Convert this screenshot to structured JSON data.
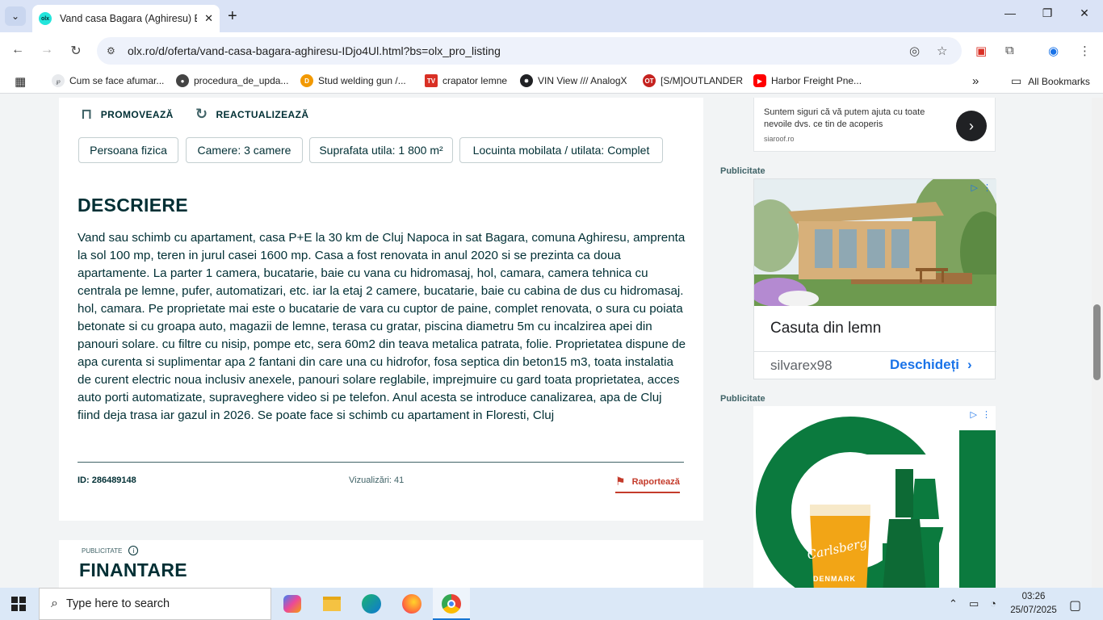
{
  "browser": {
    "tab_title": "Vand casa Bagara (Aghiresu) Ba",
    "favicon_text": "olx",
    "url": "olx.ro/d/oferta/vand-casa-bagara-aghiresu-IDjo4Ul.html?bs=olx_pro_listing",
    "bookmarks": [
      {
        "label": "Cum se face afumar...",
        "color": "#5f6368"
      },
      {
        "label": "procedura_de_upda...",
        "color": "#444"
      },
      {
        "label": "Stud welding gun /...",
        "color": "#f29900"
      },
      {
        "label": "crapator lemne",
        "color": "#d93025"
      },
      {
        "label": "VIN View /// AnalogX",
        "color": "#202124"
      },
      {
        "label": "[S/M]OUTLANDER",
        "color": "#c5221f"
      },
      {
        "label": "Harbor Freight Pne...",
        "color": "#ff0000"
      }
    ],
    "all_bookmarks": "All Bookmarks"
  },
  "listing": {
    "promote": "PROMOVEAZĂ",
    "refresh": "REACTUALIZEAZĂ",
    "tags": [
      "Persoana fizica",
      "Camere: 3 camere",
      "Suprafata utila: 1 800 m²",
      "Locuinta mobilata / utilata: Complet"
    ],
    "description_heading": "DESCRIERE",
    "description": "Vand sau schimb cu apartament, casa P+E la 30 km de Cluj Napoca in sat Bagara, comuna Aghiresu, amprenta la sol 100 mp, teren in jurul casei 1600 mp. Casa a fost renovata in anul 2020 si se prezinta ca doua apartamente. La parter 1 camera, bucatarie, baie cu vana cu hidromasaj, hol, camara, camera tehnica cu centrala pe lemne, pufer, automatizari, etc. iar la etaj 2 camere, bucatarie, baie cu cabina de dus cu hidromasaj. hol, camara. Pe proprietate mai este o bucatarie de vara cu cuptor de paine, complet renovata, o sura cu poiata betonate si cu groapa auto, magazii de lemne, terasa cu gratar, piscina diametru 5m cu incalzirea apei din panouri solare. cu filtre cu nisip, pompe etc, sera 60m2 din teava metalica patrata, folie. Proprietatea dispune de apa curenta si suplimentar apa 2 fantani din care una cu hidrofor, fosa septica din beton15 m3, toata instalatia de curent electric noua inclusiv anexele, panouri solare reglabile, imprejmuire cu gard toata proprietatea, acces auto porti automatizate, supraveghere video si pe telefon. Anul acesta se introduce canalizarea, apa de Cluj fiind deja trasa iar gazul in 2026. Se poate face si schimb cu apartament in Floresti, Cluj",
    "id_text": "ID: 286489148",
    "views_text": "Vizualizări: 41",
    "report": "Raportează",
    "publicitate_small": "PUBLICITATE",
    "finantare": "FINANTARE"
  },
  "sidebar": {
    "ad1_text": "Suntem siguri că vă putem ajuta cu toate nevoile dvs. ce tin de acoperis",
    "ad1_source": "siaroof.ro",
    "publicitate": "Publicitate",
    "ad2_title": "Casuta din lemn",
    "ad2_source": "silvarex98",
    "ad2_open": "Deschideți",
    "ad3_brand": "Carlsberg",
    "ad3_sub": "DENMARK"
  },
  "taskbar": {
    "search_placeholder": "Type here to search",
    "time": "03:26",
    "date": "25/07/2025"
  },
  "colors": {
    "olx_teal": "#23e5db",
    "text": "#002f34",
    "report": "#c43b2b",
    "carlsberg_green": "#0b7a3e"
  }
}
